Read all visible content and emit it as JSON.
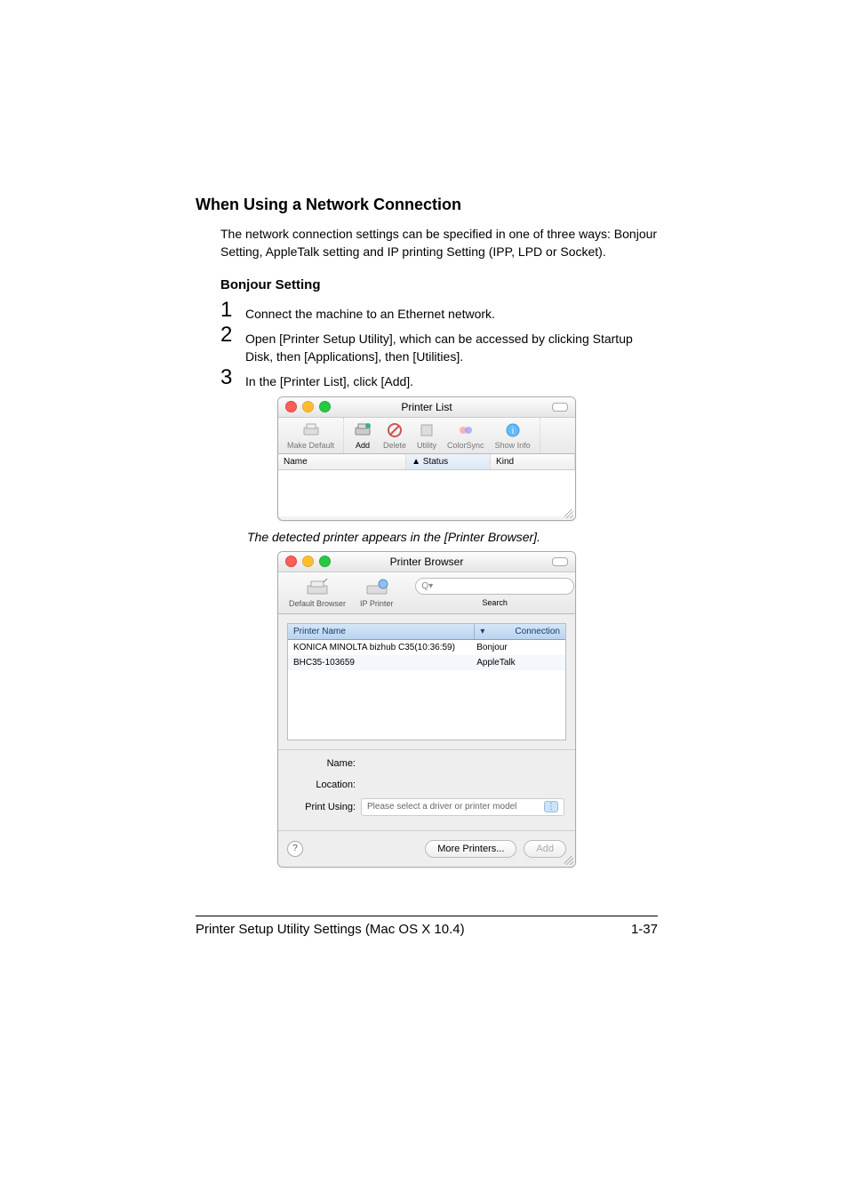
{
  "headings": {
    "h2": "When Using a Network Connection",
    "body": "The network connection settings can be specified in one of three ways: Bonjour Setting, AppleTalk setting and IP printing Setting (IPP, LPD or Socket).",
    "h3": "Bonjour Setting"
  },
  "steps": {
    "s1_num": "1",
    "s1_text": "Connect the machine to an Ethernet network.",
    "s2_num": "2",
    "s2_text": "Open [Printer Setup Utility], which can be accessed by clicking Startup Disk, then [Applications], then [Utilities].",
    "s3_num": "3",
    "s3_text": "In the [Printer List], click [Add]."
  },
  "caption": "The detected printer appears in the [Printer Browser].",
  "printerList": {
    "title": "Printer List",
    "toolbar": {
      "makeDefault": "Make Default",
      "add": "Add",
      "delete": "Delete",
      "utility": "Utility",
      "colorsync": "ColorSync",
      "showinfo": "Show Info"
    },
    "cols": {
      "name": "Name",
      "status": "Status",
      "kind": "Kind"
    }
  },
  "printerBrowser": {
    "title": "Printer Browser",
    "tabs": {
      "default": "Default Browser",
      "ip": "IP Printer",
      "searchLabel": "Search"
    },
    "searchPrefix": "Q▾",
    "listCols": {
      "name": "Printer Name",
      "conn": "Connection"
    },
    "rows": [
      {
        "name": "KONICA MINOLTA bizhub C35(10:36:59)",
        "conn": "Bonjour"
      },
      {
        "name": "BHC35-103659",
        "conn": "AppleTalk"
      }
    ],
    "form": {
      "name": "Name:",
      "location": "Location:",
      "printUsing": "Print Using:",
      "printUsingValue": "Please select a driver or printer model",
      "updown": "⋮"
    },
    "buttons": {
      "more": "More Printers...",
      "add": "Add",
      "help": "?"
    }
  },
  "footer": {
    "left": "Printer Setup Utility Settings (Mac OS X 10.4)",
    "right": "1-37"
  }
}
